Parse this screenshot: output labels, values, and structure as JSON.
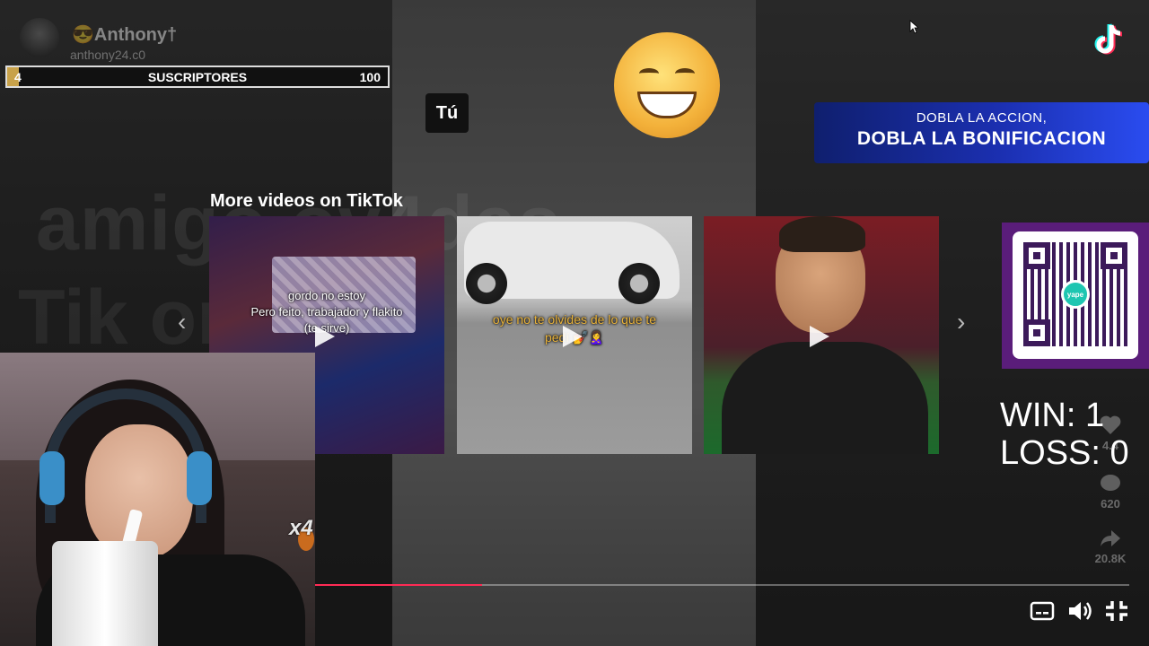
{
  "channel": {
    "name": "😎Anthony†",
    "handle": "anthony24.c0",
    "subs_start": "4",
    "subs_label": "SUSCRIPTORES",
    "subs_end": "100",
    "subs_progress": 0.03
  },
  "background": {
    "text_line1": "amigo        ov4das",
    "text_line2": "Tik         on"
  },
  "badge": {
    "you": "Tú"
  },
  "promo": {
    "line1": "DOBLA LA ACCION,",
    "line2": "DOBLA LA BONIFICACION"
  },
  "more_videos": {
    "title": "More videos on TikTok",
    "items": [
      {
        "caption": "gordo no estoy\nPero feito, trabajador y flakito\n(te sirve)"
      },
      {
        "caption": "oye no te olvides de lo que te\npedí 💅🙎‍♀️"
      },
      {
        "caption": ""
      }
    ]
  },
  "qr": {
    "brand": "yape"
  },
  "score": {
    "win": "WIN: 1",
    "loss": "LOSS: 0"
  },
  "side_actions": {
    "comments": "620",
    "shares": "20.8K",
    "likes": "4.4"
  },
  "overlay": {
    "multiplier": "x4"
  },
  "player": {
    "progress": 0.205
  },
  "icons": [
    "tiktok-logo-icon",
    "chevron-left-icon",
    "chevron-right-icon",
    "play-icon",
    "captions-icon",
    "volume-icon",
    "exit-fullscreen-icon",
    "heart-icon",
    "comment-icon",
    "share-icon"
  ],
  "colors": {
    "accent": "#ff2b55",
    "promo_blue": "#1b2fb0",
    "qr_purple": "#5a1d7a",
    "subs_gold": "#c8a24a"
  }
}
